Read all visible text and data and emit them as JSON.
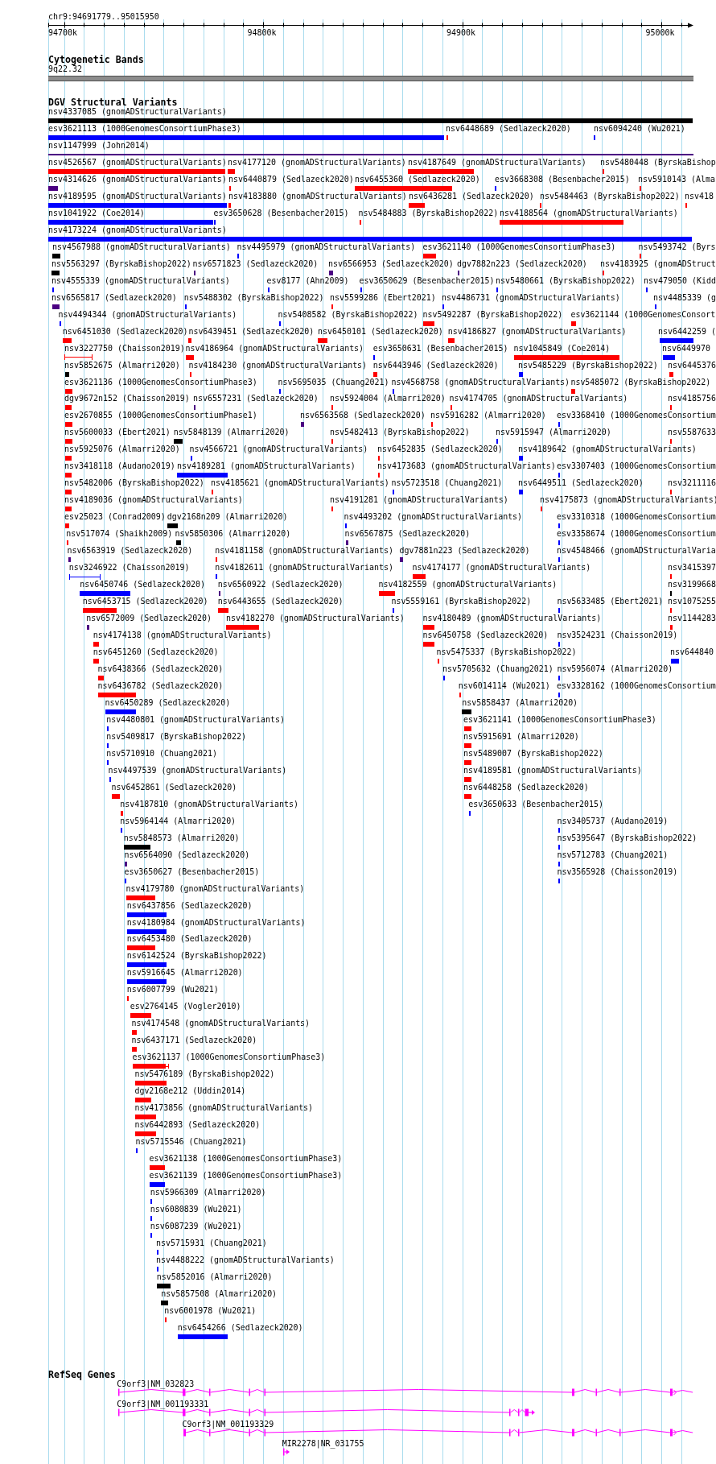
{
  "ruler": {
    "location": "chr9:94691779..95015950",
    "ticks": [
      "94700k",
      "94800k",
      "94900k",
      "95000k"
    ]
  },
  "cytoband_track": {
    "title": "Cytogenetic Bands",
    "bands": [
      {
        "label": "9q22.32"
      }
    ]
  },
  "variant_track": {
    "title": "DGV Structural Variants",
    "rows": [
      {
        "features": [
          {
            "label": "nsv4337085 (gnomADStructuralVariants)",
            "color": "#000000",
            "kind": "bar"
          }
        ]
      },
      {
        "features": [
          {
            "label": "esv3621113 (1000GenomesConsortiumPhase3)",
            "color": "#0000ff",
            "kind": "bar"
          },
          {
            "label": "nsv6448689 (Sedlazeck2020)",
            "color": "#ff0000",
            "kind": "bar"
          },
          {
            "label": "nsv6094240 (Wu2021)",
            "color": "#0000ff",
            "kind": "bar"
          }
        ]
      },
      {
        "features": [
          {
            "label": "nsv1147999 (John2014)",
            "color": "#4b0082",
            "kind": "line"
          }
        ]
      },
      {
        "features": [
          {
            "label": "nsv4526567 (gnomADStructuralVariants)",
            "color": "#ff0000",
            "kind": "bar"
          },
          {
            "label": "nsv4177120 (gnomADStructuralVariants)",
            "color": "#ff0000",
            "kind": "bar"
          },
          {
            "label": "nsv4187649 (gnomADStructuralVariants)",
            "color": "#ff0000",
            "kind": "bar"
          },
          {
            "label": "nsv5480448 (ByrskaBishop",
            "color": "#ff0000",
            "kind": "bar"
          }
        ]
      },
      {
        "features": [
          {
            "label": "nsv4314626 (gnomADStructuralVariants)",
            "color": "#4b0082",
            "kind": "bar"
          },
          {
            "label": "nsv6440879 (Sedlazeck2020)",
            "color": "#ff0000",
            "kind": "bar"
          },
          {
            "label": "nsv6455360 (Sedlazeck2020)",
            "color": "#ff0000",
            "kind": "bar"
          },
          {
            "label": "esv3668308 (Besenbacher2015)",
            "color": "#0000ff",
            "kind": "bar"
          },
          {
            "label": "nsv5910143 (Alma",
            "color": "#ff0000",
            "kind": "bar"
          }
        ]
      },
      {
        "features": [
          {
            "label": "nsv4189595 (gnomADStructuralVariants)",
            "color": "#0000ff",
            "kind": "bar"
          },
          {
            "label": "nsv4183880 (gnomADStructuralVariants)",
            "color": "#ff0000",
            "kind": "bar"
          },
          {
            "label": "nsv6436281 (Sedlazeck2020)",
            "color": "#ff0000",
            "kind": "bar"
          },
          {
            "label": "nsv5484463 (ByrskaBishop2022)",
            "color": "#ff0000",
            "kind": "bar"
          },
          {
            "label": "nsv418",
            "color": "#ff0000",
            "kind": "bar"
          }
        ]
      },
      {
        "features": [
          {
            "label": "nsv1041922 (Coe2014)",
            "color": "#0000ff",
            "kind": "bar"
          },
          {
            "label": "esv3650628 (Besenbacher2015)",
            "color": "#0000ff",
            "kind": "bar"
          },
          {
            "label": "nsv5484883 (ByrskaBishop2022)",
            "color": "#ff0000",
            "kind": "bar"
          },
          {
            "label": "nsv4188564 (gnomADStructuralVariants)",
            "color": "#ff0000",
            "kind": "bar"
          }
        ]
      },
      {
        "features": [
          {
            "label": "nsv4173224 (gnomADStructuralVariants)",
            "color": "#0000ff",
            "kind": "bar"
          }
        ]
      },
      {
        "features": [
          {
            "label": "nsv4567988 (gnomADStructuralVariants)",
            "color": "#000000",
            "kind": "bar"
          },
          {
            "label": "nsv4495979 (gnomADStructuralVariants)",
            "color": "#0000ff",
            "kind": "bar"
          },
          {
            "label": "esv3621140 (1000GenomesConsortiumPhase3)",
            "color": "#ff0000",
            "kind": "bar"
          },
          {
            "label": "nsv5493742 (Byrs",
            "color": "#ff0000",
            "kind": "bar"
          }
        ]
      },
      {
        "features": [
          {
            "label": "nsv5563297 (ByrskaBishop2022)",
            "color": "#000000",
            "kind": "bar"
          },
          {
            "label": "nsv6571823 (Sedlazeck2020)",
            "color": "#4b0082",
            "kind": "bar"
          },
          {
            "label": "nsv6566953 (Sedlazeck2020)",
            "color": "#4b0082",
            "kind": "bar"
          },
          {
            "label": "dgv7882n223 (Sedlazeck2020)",
            "color": "#4b0082",
            "kind": "bar"
          },
          {
            "label": "nsv4183925 (gnomADStruct",
            "color": "#ff0000",
            "kind": "bar"
          }
        ]
      },
      {
        "features": [
          {
            "label": "nsv4555339 (gnomADStructuralVariants)",
            "color": "#0000ff",
            "kind": "bar"
          },
          {
            "label": "esv8177 (Ahn2009)",
            "color": "#0000ff",
            "kind": "bar"
          },
          {
            "label": "esv3650629 (Besenbacher2015)",
            "color": "#0000ff",
            "kind": "bar"
          },
          {
            "label": "nsv5480661 (ByrskaBishop2022)",
            "color": "#0000ff",
            "kind": "bar"
          },
          {
            "label": "nsv479050 (Kidd",
            "color": "#0000ff",
            "kind": "bar"
          }
        ]
      },
      {
        "features": [
          {
            "label": "nsv6565817 (Sedlazeck2020)",
            "color": "#4b0082",
            "kind": "bar"
          },
          {
            "label": "nsv5488302 (ByrskaBishop2022)",
            "color": "#0000ff",
            "kind": "bar"
          },
          {
            "label": "nsv5599286 (Ebert2021)",
            "color": "#ff0000",
            "kind": "bar"
          },
          {
            "label": "nsv4486731 (gnomADStructuralVariants)",
            "color": "#0000ff",
            "kind": "bar"
          },
          {
            "label": "nsv4485339 (g",
            "color": "#0000ff",
            "kind": "bar"
          }
        ]
      },
      {
        "features": [
          {
            "label": "nsv4494344 (gnomADStructuralVariants)",
            "color": "#0000ff",
            "kind": "bar"
          },
          {
            "label": "nsv5408582 (ByrskaBishop2022)",
            "color": "#0000ff",
            "kind": "bar"
          },
          {
            "label": "nsv5492287 (ByrskaBishop2022)",
            "color": "#ff0000",
            "kind": "bar"
          },
          {
            "label": "esv3621144 (1000GenomesConsort",
            "color": "#ff0000",
            "kind": "bar"
          }
        ]
      },
      {
        "features": [
          {
            "label": "nsv6451030 (Sedlazeck2020)",
            "color": "#ff0000",
            "kind": "bar"
          },
          {
            "label": "nsv6439451 (Sedlazeck2020)",
            "color": "#ff0000",
            "kind": "bar"
          },
          {
            "label": "nsv6450101 (Sedlazeck2020)",
            "color": "#ff0000",
            "kind": "bar"
          },
          {
            "label": "nsv4186827 (gnomADStructuralVariants)",
            "color": "#ff0000",
            "kind": "bar"
          },
          {
            "label": "nsv6442259 (",
            "color": "#0000ff",
            "kind": "bar"
          }
        ]
      },
      {
        "features": [
          {
            "label": "nsv3227750 (Chaisson2019)",
            "color": "#ff0000",
            "kind": "span"
          },
          {
            "label": "nsv4186964 (gnomADStructuralVariants)",
            "color": "#ff0000",
            "kind": "bar"
          },
          {
            "label": "esv3650631 (Besenbacher2015)",
            "color": "#0000ff",
            "kind": "bar"
          },
          {
            "label": "nsv1045849 (Coe2014)",
            "color": "#ff0000",
            "kind": "bar"
          },
          {
            "label": "nsv6449970",
            "color": "#0000ff",
            "kind": "bar"
          }
        ]
      },
      {
        "features": [
          {
            "label": "nsv5852675 (Almarri2020)",
            "color": "#000000",
            "kind": "bar"
          },
          {
            "label": "nsv4184230 (gnomADStructuralVariants)",
            "color": "#ff0000",
            "kind": "bar"
          },
          {
            "label": "nsv6443946 (Sedlazeck2020)",
            "color": "#ff0000",
            "kind": "bar"
          },
          {
            "label": "nsv5485229 (ByrskaBishop2022)",
            "color": "#0000ff",
            "kind": "bar"
          },
          {
            "label": "nsv6445376",
            "color": "#ff0000",
            "kind": "bar"
          }
        ]
      },
      {
        "features": [
          {
            "label": "esv3621136 (1000GenomesConsortiumPhase3)",
            "color": "#ff0000",
            "kind": "bar"
          },
          {
            "label": "nsv5695035 (Chuang2021)",
            "color": "#0000ff",
            "kind": "bar"
          },
          {
            "label": "nsv4568758 (gnomADStructuralVariants)",
            "color": "#0000ff",
            "kind": "bar"
          },
          {
            "label": "nsv5485072 (ByrskaBishop2022)",
            "color": "#ff0000",
            "kind": "bar"
          }
        ]
      },
      {
        "features": [
          {
            "label": "dgv9672n152 (Chaisson2019)",
            "color": "#ff0000",
            "kind": "bar"
          },
          {
            "label": "nsv6557231 (Sedlazeck2020)",
            "color": "#4b0082",
            "kind": "bar"
          },
          {
            "label": "nsv5924004 (Almarri2020)",
            "color": "#ff0000",
            "kind": "bar"
          },
          {
            "label": "nsv4174705 (gnomADStructuralVariants)",
            "color": "#ff0000",
            "kind": "bar"
          },
          {
            "label": "nsv4185756",
            "color": "#ff0000",
            "kind": "bar"
          }
        ]
      },
      {
        "features": [
          {
            "label": "esv2670855 (1000GenomesConsortiumPhase1)",
            "color": "#ff0000",
            "kind": "bar"
          },
          {
            "label": "nsv6563568 (Sedlazeck2020)",
            "color": "#4b0082",
            "kind": "bar"
          },
          {
            "label": "nsv5916282 (Almarri2020)",
            "color": "#ff0000",
            "kind": "bar"
          },
          {
            "label": "esv3368410 (1000GenomesConsortium",
            "color": "#0000ff",
            "kind": "bar"
          }
        ]
      },
      {
        "features": [
          {
            "label": "nsv5600033 (Ebert2021)",
            "color": "#ff0000",
            "kind": "bar"
          },
          {
            "label": "nsv5848139 (Almarri2020)",
            "color": "#000000",
            "kind": "bar"
          },
          {
            "label": "nsv5482413 (ByrskaBishop2022)",
            "color": "#ff0000",
            "kind": "bar"
          },
          {
            "label": "nsv5915947 (Almarri2020)",
            "color": "#0000ff",
            "kind": "bar"
          },
          {
            "label": "nsv5587633",
            "color": "#ff0000",
            "kind": "bar"
          }
        ]
      },
      {
        "features": [
          {
            "label": "nsv5925076 (Almarri2020)",
            "color": "#ff0000",
            "kind": "bar"
          },
          {
            "label": "nsv4566721 (gnomADStructuralVariants)",
            "color": "#0000ff",
            "kind": "bar"
          },
          {
            "label": "nsv6452835 (Sedlazeck2020)",
            "color": "#ff0000",
            "kind": "bar"
          },
          {
            "label": "nsv4189642 (gnomADStructuralVariants)",
            "color": "#0000ff",
            "kind": "bar"
          }
        ]
      },
      {
        "features": [
          {
            "label": "nsv3418118 (Audano2019)",
            "color": "#ff0000",
            "kind": "bar"
          },
          {
            "label": "nsv4189281 (gnomADStructuralVariants)",
            "color": "#0000ff",
            "kind": "bar"
          },
          {
            "label": "nsv4173683 (gnomADStructuralVariants)",
            "color": "#ff0000",
            "kind": "bar"
          },
          {
            "label": "esv3307403 (1000GenomesConsortium",
            "color": "#0000ff",
            "kind": "bar"
          }
        ]
      },
      {
        "features": [
          {
            "label": "nsv5482006 (ByrskaBishop2022)",
            "color": "#ff0000",
            "kind": "bar"
          },
          {
            "label": "nsv4185621 (gnomADStructuralVariants)",
            "color": "#ff0000",
            "kind": "bar"
          },
          {
            "label": "nsv5723518 (Chuang2021)",
            "color": "#0000ff",
            "kind": "bar"
          },
          {
            "label": "nsv6449511 (Sedlazeck2020)",
            "color": "#0000ff",
            "kind": "bar"
          },
          {
            "label": "nsv3211116",
            "color": "#ff0000",
            "kind": "bar"
          }
        ]
      },
      {
        "features": [
          {
            "label": "nsv4189036 (gnomADStructuralVariants)",
            "color": "#ff0000",
            "kind": "bar"
          },
          {
            "label": "nsv4191281 (gnomADStructuralVariants)",
            "color": "#ff0000",
            "kind": "bar"
          },
          {
            "label": "nsv4175873 (gnomADStructuralVariants)",
            "color": "#ff0000",
            "kind": "bar"
          }
        ]
      },
      {
        "features": [
          {
            "label": "esv25023 (Conrad2009)",
            "color": "#ff0000",
            "kind": "bar"
          },
          {
            "label": "dgv2168n209 (Almarri2020)",
            "color": "#000000",
            "kind": "bar"
          },
          {
            "label": "nsv4493202 (gnomADStructuralVariants)",
            "color": "#0000ff",
            "kind": "bar"
          },
          {
            "label": "esv3310318 (1000GenomesConsortium",
            "color": "#0000ff",
            "kind": "bar"
          }
        ]
      },
      {
        "features": [
          {
            "label": "nsv517074 (Shaikh2009)",
            "color": "#ff0000",
            "kind": "bar"
          },
          {
            "label": "nsv5850306 (Almarri2020)",
            "color": "#000000",
            "kind": "bar"
          },
          {
            "label": "nsv6567875 (Sedlazeck2020)",
            "color": "#4b0082",
            "kind": "bar"
          },
          {
            "label": "esv3358674 (1000GenomesConsortium",
            "color": "#0000ff",
            "kind": "bar"
          }
        ]
      },
      {
        "features": [
          {
            "label": "nsv6563919 (Sedlazeck2020)",
            "color": "#4b0082",
            "kind": "bar"
          },
          {
            "label": "nsv4181158 (gnomADStructuralVariants)",
            "color": "#ff0000",
            "kind": "bar"
          },
          {
            "label": "dgv7881n223 (Sedlazeck2020)",
            "color": "#4b0082",
            "kind": "bar"
          },
          {
            "label": "nsv4548466 (gnomADStructuralVaria",
            "color": "#0000ff",
            "kind": "bar"
          }
        ]
      },
      {
        "features": [
          {
            "label": "nsv3246922 (Chaisson2019)",
            "color": "#0000ff",
            "kind": "span"
          },
          {
            "label": "nsv4182611 (gnomADStructuralVariants)",
            "color": "#0000ff",
            "kind": "bar"
          },
          {
            "label": "nsv4174177 (gnomADStructuralVariants)",
            "color": "#ff0000",
            "kind": "bar"
          },
          {
            "label": "nsv3415397",
            "color": "#ff0000",
            "kind": "bar"
          }
        ]
      },
      {
        "features": [
          {
            "label": "nsv6450746 (Sedlazeck2020)",
            "color": "#0000ff",
            "kind": "bar"
          },
          {
            "label": "nsv6560922 (Sedlazeck2020)",
            "color": "#4b0082",
            "kind": "bar"
          },
          {
            "label": "nsv4182559 (gnomADStructuralVariants)",
            "color": "#ff0000",
            "kind": "bar"
          },
          {
            "label": "nsv3199668",
            "color": "#000000",
            "kind": "bar"
          }
        ]
      },
      {
        "features": [
          {
            "label": "nsv6453715 (Sedlazeck2020)",
            "color": "#ff0000",
            "kind": "bar"
          },
          {
            "label": "nsv6443655 (Sedlazeck2020)",
            "color": "#ff0000",
            "kind": "bar"
          },
          {
            "label": "nsv5559161 (ByrskaBishop2022)",
            "color": "#0000ff",
            "kind": "bar"
          },
          {
            "label": "nsv5633485 (Ebert2021)",
            "color": "#0000ff",
            "kind": "bar"
          },
          {
            "label": "nsv1075255",
            "color": "#ff0000",
            "kind": "bar"
          }
        ]
      },
      {
        "features": [
          {
            "label": "nsv6572009 (Sedlazeck2020)",
            "color": "#4b0082",
            "kind": "bar"
          },
          {
            "label": "nsv4182270 (gnomADStructuralVariants)",
            "color": "#ff0000",
            "kind": "bar"
          },
          {
            "label": "nsv4180489 (gnomADStructuralVariants)",
            "color": "#ff0000",
            "kind": "bar"
          },
          {
            "label": "nsv1144283",
            "color": "#ff0000",
            "kind": "bar"
          }
        ]
      },
      {
        "features": [
          {
            "label": "nsv4174138 (gnomADStructuralVariants)",
            "color": "#ff0000",
            "kind": "bar"
          },
          {
            "label": "nsv6450758 (Sedlazeck2020)",
            "color": "#ff0000",
            "kind": "bar"
          },
          {
            "label": "nsv3524231 (Chaisson2019)",
            "color": "#0000ff",
            "kind": "bar"
          }
        ]
      },
      {
        "features": [
          {
            "label": "nsv6451260 (Sedlazeck2020)",
            "color": "#ff0000",
            "kind": "bar"
          },
          {
            "label": "nsv5475337 (ByrskaBishop2022)",
            "color": "#ff0000",
            "kind": "bar"
          },
          {
            "label": "nsv644840",
            "color": "#0000ff",
            "kind": "bar"
          }
        ]
      },
      {
        "features": [
          {
            "label": "nsv6438366 (Sedlazeck2020)",
            "color": "#ff0000",
            "kind": "bar"
          },
          {
            "label": "nsv5705632 (Chuang2021)",
            "color": "#0000ff",
            "kind": "bar"
          },
          {
            "label": "nsv5956074 (Almarri2020)",
            "color": "#0000ff",
            "kind": "bar"
          }
        ]
      },
      {
        "features": [
          {
            "label": "nsv6436782 (Sedlazeck2020)",
            "color": "#ff0000",
            "kind": "bar"
          },
          {
            "label": "nsv6014114 (Wu2021)",
            "color": "#ff0000",
            "kind": "bar"
          },
          {
            "label": "esv3328162 (1000GenomesConsortium",
            "color": "#0000ff",
            "kind": "bar"
          }
        ]
      },
      {
        "features": [
          {
            "label": "nsv6450289 (Sedlazeck2020)",
            "color": "#0000ff",
            "kind": "bar"
          },
          {
            "label": "nsv5858437 (Almarri2020)",
            "color": "#000000",
            "kind": "bar"
          }
        ]
      },
      {
        "features": [
          {
            "label": "nsv4480801 (gnomADStructuralVariants)",
            "color": "#0000ff",
            "kind": "bar"
          },
          {
            "label": "esv3621141 (1000GenomesConsortiumPhase3)",
            "color": "#ff0000",
            "kind": "bar"
          }
        ]
      },
      {
        "features": [
          {
            "label": "nsv5409817 (ByrskaBishop2022)",
            "color": "#0000ff",
            "kind": "bar"
          },
          {
            "label": "nsv5915691 (Almarri2020)",
            "color": "#ff0000",
            "kind": "bar"
          }
        ]
      },
      {
        "features": [
          {
            "label": "nsv5710910 (Chuang2021)",
            "color": "#0000ff",
            "kind": "bar"
          },
          {
            "label": "nsv5489007 (ByrskaBishop2022)",
            "color": "#ff0000",
            "kind": "bar"
          }
        ]
      },
      {
        "features": [
          {
            "label": "nsv4497539 (gnomADStructuralVariants)",
            "color": "#0000ff",
            "kind": "bar"
          },
          {
            "label": "nsv4189581 (gnomADStructuralVariants)",
            "color": "#ff0000",
            "kind": "bar"
          }
        ]
      },
      {
        "features": [
          {
            "label": "nsv6452861 (Sedlazeck2020)",
            "color": "#ff0000",
            "kind": "bar"
          },
          {
            "label": "nsv6448258 (Sedlazeck2020)",
            "color": "#ff0000",
            "kind": "bar"
          }
        ]
      },
      {
        "features": [
          {
            "label": "nsv4187810 (gnomADStructuralVariants)",
            "color": "#ff0000",
            "kind": "bar"
          },
          {
            "label": "esv3650633 (Besenbacher2015)",
            "color": "#0000ff",
            "kind": "bar"
          }
        ]
      },
      {
        "features": [
          {
            "label": "nsv5964144 (Almarri2020)",
            "color": "#0000ff",
            "kind": "bar"
          },
          {
            "label": "nsv3405737 (Audano2019)",
            "color": "#0000ff",
            "kind": "bar"
          }
        ]
      },
      {
        "features": [
          {
            "label": "nsv5848573 (Almarri2020)",
            "color": "#000000",
            "kind": "bar"
          },
          {
            "label": "nsv5395647 (ByrskaBishop2022)",
            "color": "#0000ff",
            "kind": "bar"
          }
        ]
      },
      {
        "features": [
          {
            "label": "nsv6564090 (Sedlazeck2020)",
            "color": "#4b0082",
            "kind": "bar"
          },
          {
            "label": "nsv5712783 (Chuang2021)",
            "color": "#0000ff",
            "kind": "bar"
          }
        ]
      },
      {
        "features": [
          {
            "label": "esv3650627 (Besenbacher2015)",
            "color": "#0000ff",
            "kind": "bar"
          },
          {
            "label": "nsv3565928 (Chaisson2019)",
            "color": "#0000ff",
            "kind": "bar"
          }
        ]
      },
      {
        "features": [
          {
            "label": "nsv4179780 (gnomADStructuralVariants)",
            "color": "#ff0000",
            "kind": "bar"
          }
        ]
      },
      {
        "features": [
          {
            "label": "nsv6437856 (Sedlazeck2020)",
            "color": "#0000ff",
            "kind": "bar"
          }
        ]
      },
      {
        "features": [
          {
            "label": "nsv4180984 (gnomADStructuralVariants)",
            "color": "#0000ff",
            "kind": "bar"
          }
        ]
      },
      {
        "features": [
          {
            "label": "nsv6453480 (Sedlazeck2020)",
            "color": "#ff0000",
            "kind": "bar"
          }
        ]
      },
      {
        "features": [
          {
            "label": "nsv6142524 (ByrskaBishop2022)",
            "color": "#0000ff",
            "kind": "bar"
          }
        ]
      },
      {
        "features": [
          {
            "label": "nsv5916645 (Almarri2020)",
            "color": "#0000ff",
            "kind": "bar"
          }
        ]
      },
      {
        "features": [
          {
            "label": "nsv6007799 (Wu2021)",
            "color": "#ff0000",
            "kind": "bar"
          }
        ]
      },
      {
        "features": [
          {
            "label": "esv2764145 (Vogler2010)",
            "color": "#ff0000",
            "kind": "bar"
          }
        ]
      },
      {
        "features": [
          {
            "label": "nsv4174548 (gnomADStructuralVariants)",
            "color": "#ff0000",
            "kind": "bar"
          }
        ]
      },
      {
        "features": [
          {
            "label": "nsv6437171 (Sedlazeck2020)",
            "color": "#ff0000",
            "kind": "bar"
          }
        ]
      },
      {
        "features": [
          {
            "label": "esv3621137 (1000GenomesConsortiumPhase3)",
            "color": "#ff0000",
            "kind": "capped"
          }
        ]
      },
      {
        "features": [
          {
            "label": "nsv5476189 (ByrskaBishop2022)",
            "color": "#ff0000",
            "kind": "bar"
          }
        ]
      },
      {
        "features": [
          {
            "label": "dgv2168e212 (Uddin2014)",
            "color": "#ff0000",
            "kind": "bar"
          }
        ]
      },
      {
        "features": [
          {
            "label": "nsv4173856 (gnomADStructuralVariants)",
            "color": "#ff0000",
            "kind": "bar"
          }
        ]
      },
      {
        "features": [
          {
            "label": "nsv6442893 (Sedlazeck2020)",
            "color": "#ff0000",
            "kind": "bar"
          }
        ]
      },
      {
        "features": [
          {
            "label": "nsv5715546 (Chuang2021)",
            "color": "#0000ff",
            "kind": "bar"
          }
        ]
      },
      {
        "features": [
          {
            "label": "esv3621138 (1000GenomesConsortiumPhase3)",
            "color": "#ff0000",
            "kind": "bar"
          }
        ]
      },
      {
        "features": [
          {
            "label": "esv3621139 (1000GenomesConsortiumPhase3)",
            "color": "#0000ff",
            "kind": "bar"
          }
        ]
      },
      {
        "features": [
          {
            "label": "nsv5966309 (Almarri2020)",
            "color": "#0000ff",
            "kind": "bar"
          }
        ]
      },
      {
        "features": [
          {
            "label": "nsv6080839 (Wu2021)",
            "color": "#0000ff",
            "kind": "bar"
          }
        ]
      },
      {
        "features": [
          {
            "label": "nsv6087239 (Wu2021)",
            "color": "#0000ff",
            "kind": "bar"
          }
        ]
      },
      {
        "features": [
          {
            "label": "nsv5715931 (Chuang2021)",
            "color": "#0000ff",
            "kind": "bar"
          }
        ]
      },
      {
        "features": [
          {
            "label": "nsv4488222 (gnomADStructuralVariants)",
            "color": "#0000ff",
            "kind": "bar"
          }
        ]
      },
      {
        "features": [
          {
            "label": "nsv5852016 (Almarri2020)",
            "color": "#000000",
            "kind": "bar"
          }
        ]
      },
      {
        "features": [
          {
            "label": "nsv5857508 (Almarri2020)",
            "color": "#000000",
            "kind": "bar"
          }
        ]
      },
      {
        "features": [
          {
            "label": "nsv6001978 (Wu2021)",
            "color": "#ff0000",
            "kind": "bar"
          }
        ]
      },
      {
        "features": [
          {
            "label": "nsv6454266 (Sedlazeck2020)",
            "color": "#0000ff",
            "kind": "bar"
          }
        ]
      }
    ]
  },
  "gene_track": {
    "title": "RefSeq Genes",
    "genes": [
      {
        "label": "C9orf3|NM_032823"
      },
      {
        "label": "C9orf3|NM_001193331"
      },
      {
        "label": "C9orf3|NM_001193329"
      },
      {
        "label": "MIR2278|NR_031755"
      }
    ]
  }
}
